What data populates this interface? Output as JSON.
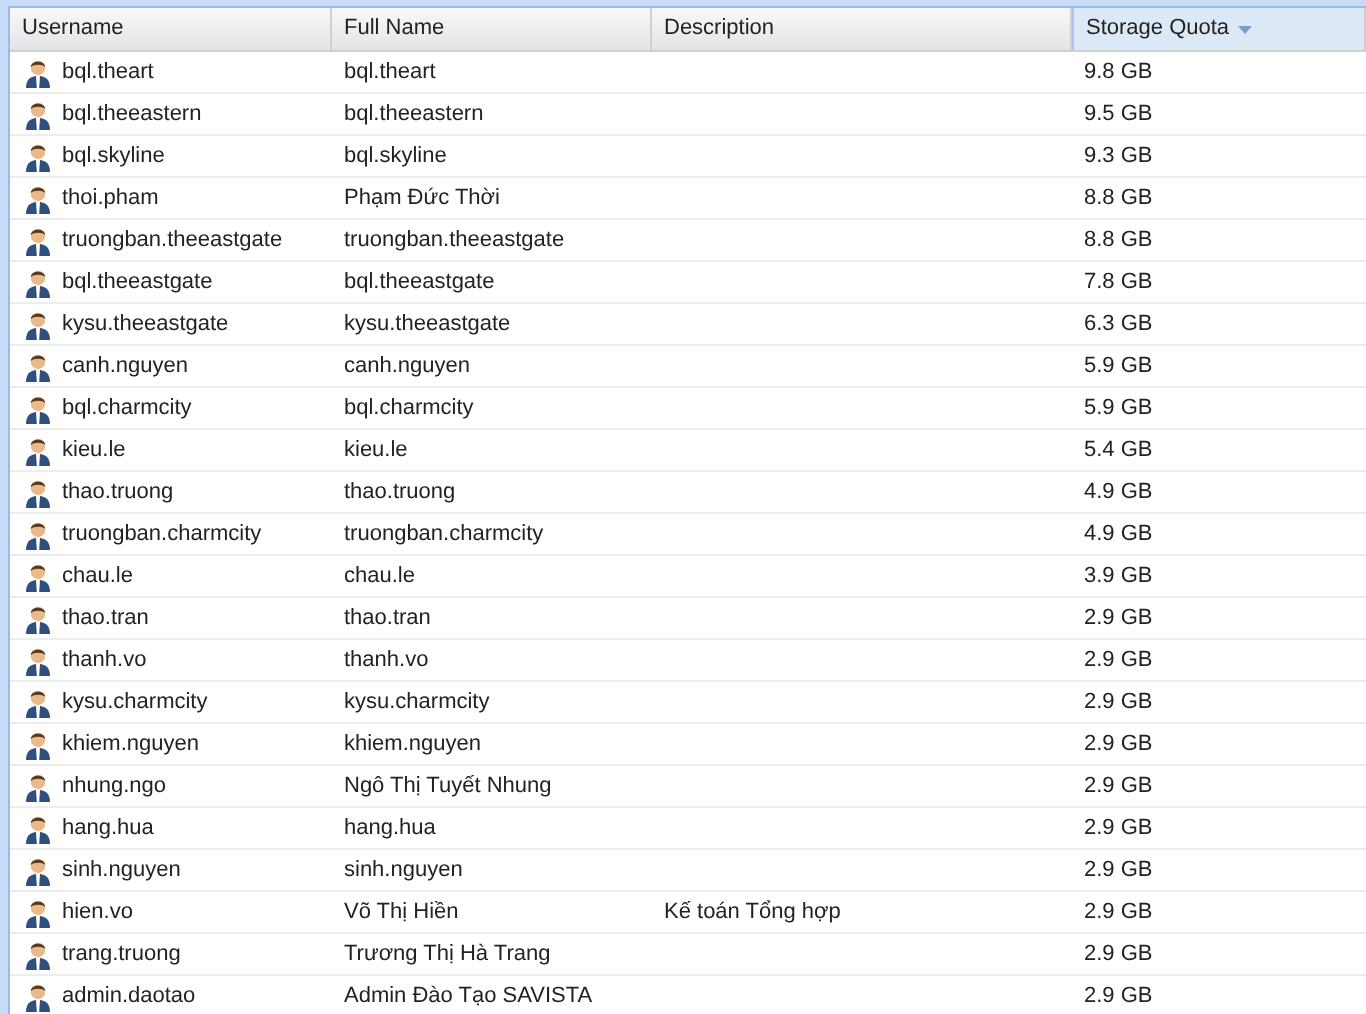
{
  "table": {
    "columns": [
      {
        "label": "Username",
        "sorted": false
      },
      {
        "label": "Full Name",
        "sorted": false
      },
      {
        "label": "Description",
        "sorted": false
      },
      {
        "label": "Storage Quota",
        "sorted": true
      }
    ],
    "rows": [
      {
        "username": "bql.theart",
        "full_name": "bql.theart",
        "description": "",
        "quota": "9.8 GB"
      },
      {
        "username": "bql.theeastern",
        "full_name": "bql.theeastern",
        "description": "",
        "quota": "9.5 GB"
      },
      {
        "username": "bql.skyline",
        "full_name": "bql.skyline",
        "description": "",
        "quota": "9.3 GB"
      },
      {
        "username": "thoi.pham",
        "full_name": "Phạm Đức Thời",
        "description": "",
        "quota": "8.8 GB"
      },
      {
        "username": "truongban.theeastgate",
        "full_name": "truongban.theeastgate",
        "description": "",
        "quota": "8.8 GB"
      },
      {
        "username": "bql.theeastgate",
        "full_name": "bql.theeastgate",
        "description": "",
        "quota": "7.8 GB"
      },
      {
        "username": "kysu.theeastgate",
        "full_name": "kysu.theeastgate",
        "description": "",
        "quota": "6.3 GB"
      },
      {
        "username": "canh.nguyen",
        "full_name": "canh.nguyen",
        "description": "",
        "quota": "5.9 GB"
      },
      {
        "username": "bql.charmcity",
        "full_name": "bql.charmcity",
        "description": "",
        "quota": "5.9 GB"
      },
      {
        "username": "kieu.le",
        "full_name": "kieu.le",
        "description": "",
        "quota": "5.4 GB"
      },
      {
        "username": "thao.truong",
        "full_name": "thao.truong",
        "description": "",
        "quota": "4.9 GB"
      },
      {
        "username": "truongban.charmcity",
        "full_name": "truongban.charmcity",
        "description": "",
        "quota": "4.9 GB"
      },
      {
        "username": "chau.le",
        "full_name": "chau.le",
        "description": "",
        "quota": "3.9 GB"
      },
      {
        "username": "thao.tran",
        "full_name": "thao.tran",
        "description": "",
        "quota": "2.9 GB"
      },
      {
        "username": "thanh.vo",
        "full_name": "thanh.vo",
        "description": "",
        "quota": "2.9 GB"
      },
      {
        "username": "kysu.charmcity",
        "full_name": "kysu.charmcity",
        "description": "",
        "quota": "2.9 GB"
      },
      {
        "username": "khiem.nguyen",
        "full_name": "khiem.nguyen",
        "description": "",
        "quota": "2.9 GB"
      },
      {
        "username": "nhung.ngo",
        "full_name": "Ngô Thị Tuyết Nhung",
        "description": "",
        "quota": "2.9 GB"
      },
      {
        "username": "hang.hua",
        "full_name": "hang.hua",
        "description": "",
        "quota": "2.9 GB"
      },
      {
        "username": "sinh.nguyen",
        "full_name": "sinh.nguyen",
        "description": "",
        "quota": "2.9 GB"
      },
      {
        "username": "hien.vo",
        "full_name": "Võ Thị Hiền",
        "description": "Kế toán Tổng hợp",
        "quota": "2.9 GB"
      },
      {
        "username": "trang.truong",
        "full_name": "Trương Thị Hà Trang",
        "description": "",
        "quota": "2.9 GB"
      },
      {
        "username": "admin.daotao",
        "full_name": "Admin Đào Tạo SAVISTA",
        "description": "",
        "quota": "2.9 GB"
      }
    ]
  }
}
